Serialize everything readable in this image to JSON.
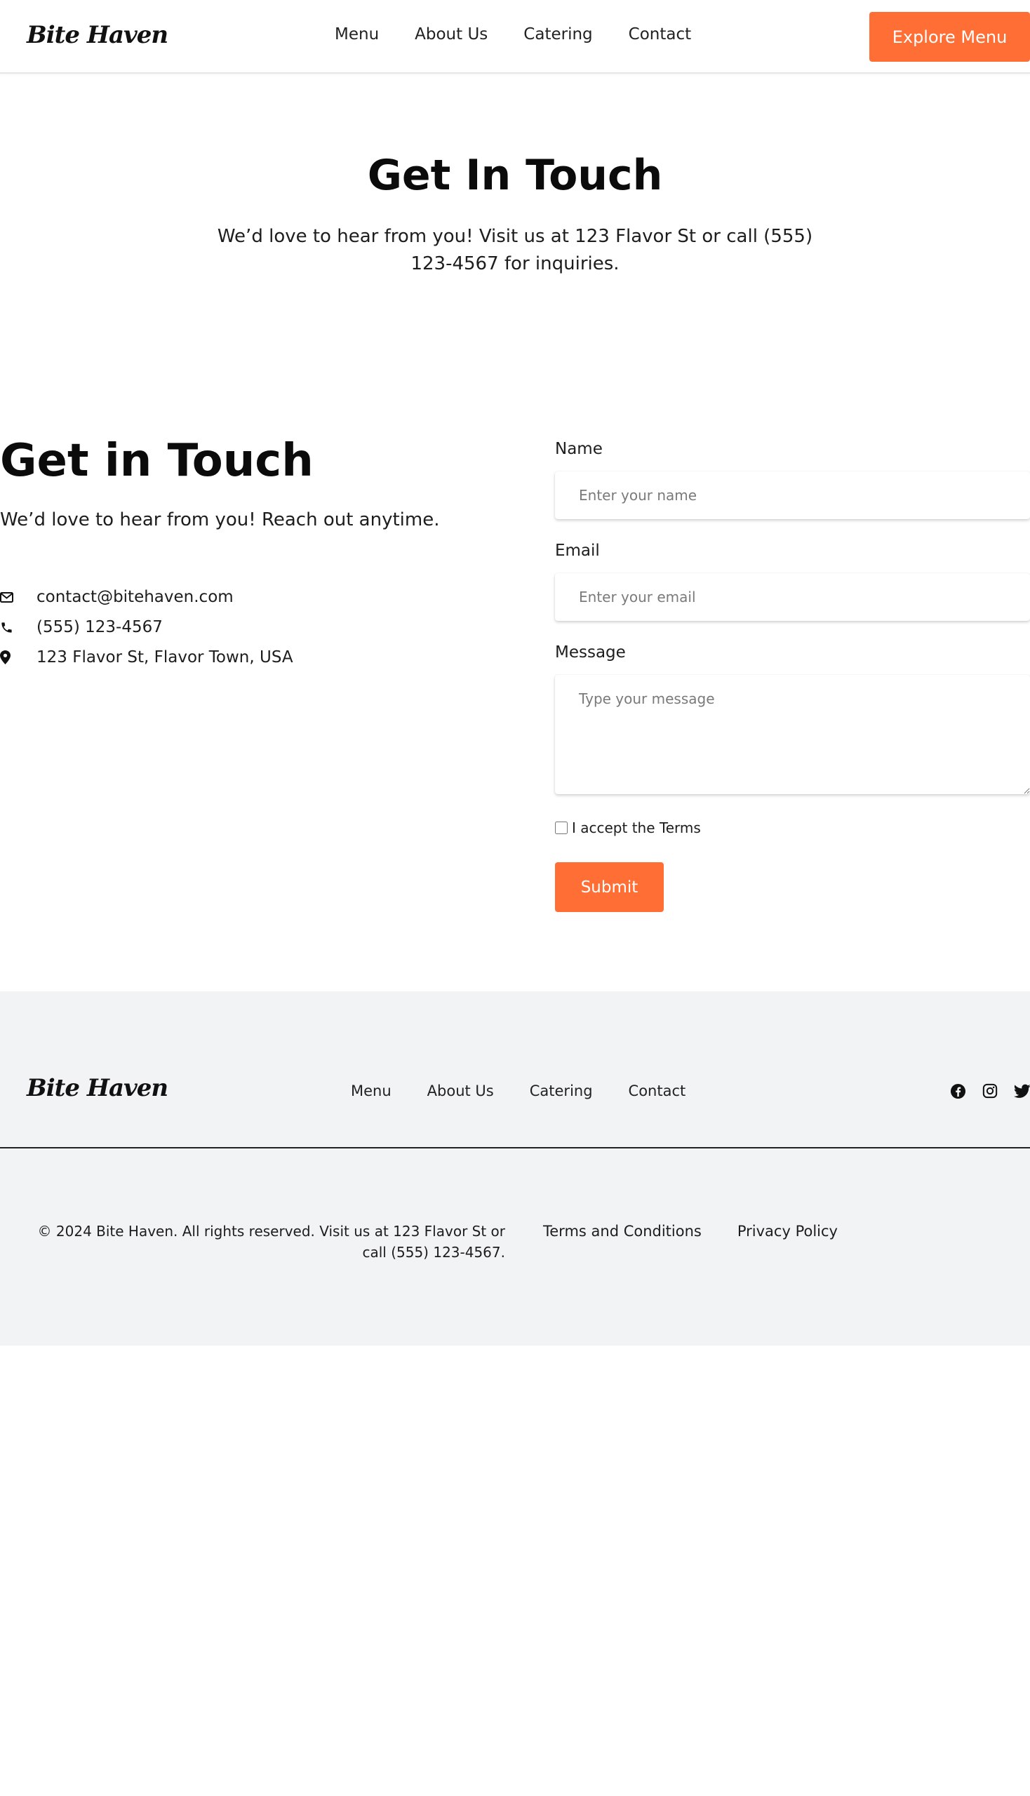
{
  "header": {
    "logo": "Bite Haven",
    "nav": [
      "Menu",
      "About Us",
      "Catering",
      "Contact"
    ],
    "cta": "Explore Menu"
  },
  "hero": {
    "title": "Get In Touch",
    "text": "We’d love to hear from you! Visit us at 123 Flavor St or call (555) 123-4567 for inquiries."
  },
  "contact": {
    "title": "Get in Touch",
    "subtitle": "We’d love to hear from you! Reach out anytime.",
    "email": "contact@bitehaven.com",
    "phone": "(555) 123-4567",
    "address": "123 Flavor St, Flavor Town, USA"
  },
  "form": {
    "name_label": "Name",
    "name_placeholder": "Enter your name",
    "email_label": "Email",
    "email_placeholder": "Enter your email",
    "message_label": "Message",
    "message_placeholder": "Type your message",
    "terms_label": "I accept the Terms",
    "submit": "Submit"
  },
  "footer": {
    "logo": "Bite Haven",
    "nav": [
      "Menu",
      "About Us",
      "Catering",
      "Contact"
    ],
    "socials": [
      "facebook-icon",
      "instagram-icon",
      "twitter-icon"
    ],
    "copyright": "© 2024 Bite Haven. All rights reserved. Visit us at 123 Flavor St or call (555) 123-4567.",
    "legal": [
      "Terms and Conditions",
      "Privacy Policy"
    ]
  },
  "colors": {
    "accent": "#ff6f35",
    "footer_bg": "#f2f3f5",
    "text": "#111111"
  }
}
